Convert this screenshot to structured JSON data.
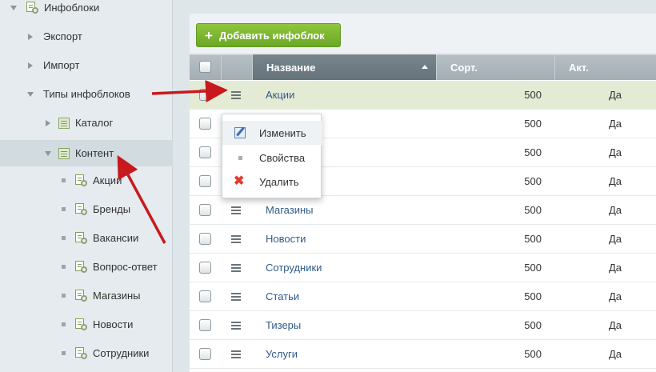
{
  "sidebar": {
    "root": {
      "label": "Инфоблоки"
    },
    "export": {
      "label": "Экспорт"
    },
    "import": {
      "label": "Импорт"
    },
    "types": {
      "label": "Типы инфоблоков"
    },
    "catalog": {
      "label": "Каталог"
    },
    "content": {
      "label": "Контент"
    },
    "children": [
      {
        "label": "Акции"
      },
      {
        "label": "Бренды"
      },
      {
        "label": "Вакансии"
      },
      {
        "label": "Вопрос-ответ"
      },
      {
        "label": "Магазины"
      },
      {
        "label": "Новости"
      },
      {
        "label": "Сотрудники"
      }
    ]
  },
  "toolbar": {
    "add_label": "Добавить инфоблок",
    "add_icon": "plus-icon"
  },
  "table": {
    "headers": {
      "name": "Название",
      "sort": "Сорт.",
      "active": "Акт."
    },
    "rows": [
      {
        "name": "Акции",
        "sort": "500",
        "active": "Да"
      },
      {
        "name": "",
        "sort": "500",
        "active": "Да"
      },
      {
        "name": "",
        "sort": "500",
        "active": "Да"
      },
      {
        "name": "ет",
        "sort": "500",
        "active": "Да"
      },
      {
        "name": "Магазины",
        "sort": "500",
        "active": "Да"
      },
      {
        "name": "Новости",
        "sort": "500",
        "active": "Да"
      },
      {
        "name": "Сотрудники",
        "sort": "500",
        "active": "Да"
      },
      {
        "name": "Статьи",
        "sort": "500",
        "active": "Да"
      },
      {
        "name": "Тизеры",
        "sort": "500",
        "active": "Да"
      },
      {
        "name": "Услуги",
        "sort": "500",
        "active": "Да"
      }
    ]
  },
  "context_menu": {
    "items": [
      {
        "label": "Изменить",
        "icon": "edit-icon"
      },
      {
        "label": "Свойства",
        "icon": "dot-icon"
      },
      {
        "label": "Удалить",
        "icon": "delete-icon"
      }
    ]
  },
  "colors": {
    "accent_green": "#7ab733",
    "link_blue": "#2f5b8a",
    "annotation_red": "#c8191e",
    "highlight_row": "#e4ebd4"
  }
}
